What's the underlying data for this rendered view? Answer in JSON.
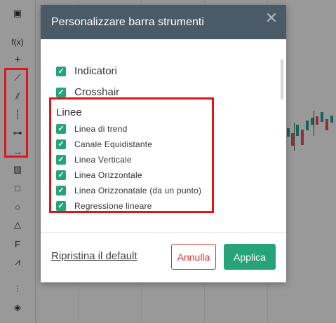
{
  "toolbar": {
    "tools": [
      {
        "icon": "chart-type-icon",
        "glyph": "▣"
      },
      {
        "icon": "function-icon",
        "glyph": "f(x)"
      },
      {
        "icon": "crosshair-icon",
        "glyph": "+"
      },
      {
        "icon": "trend-line-icon",
        "glyph": "⟋"
      },
      {
        "icon": "equidistant-channel-icon",
        "glyph": "⫽"
      },
      {
        "icon": "vertical-line-icon",
        "glyph": "┆"
      },
      {
        "icon": "horizontal-line-icon",
        "glyph": "⊶"
      },
      {
        "icon": "horizontal-ray-icon",
        "glyph": "→"
      },
      {
        "icon": "volume-profile-icon",
        "glyph": "▥"
      },
      {
        "icon": "rectangle-icon",
        "glyph": "□"
      },
      {
        "icon": "circle-icon",
        "glyph": "○"
      },
      {
        "icon": "triangle-icon",
        "glyph": "△"
      },
      {
        "icon": "fibonacci-icon",
        "glyph": "F"
      },
      {
        "icon": "zigzag-icon",
        "glyph": "⩘"
      },
      {
        "icon": "indicator-settings-icon",
        "glyph": "⫶"
      },
      {
        "icon": "layers-icon",
        "glyph": "◈"
      }
    ]
  },
  "modal": {
    "title": "Personalizzare barra strumenti",
    "close_glyph": "✕",
    "check_glyph": "✓",
    "top_items": [
      {
        "label": "Indicatori"
      },
      {
        "label": "Crosshair"
      }
    ],
    "section_title": "Linee",
    "section_items": [
      {
        "label": "Linea di trend"
      },
      {
        "label": "Canale Equidistante"
      },
      {
        "label": "Linea Verticale"
      },
      {
        "label": "Linea Orizzontale"
      },
      {
        "label": "Linea Orizzonatale (da un punto)"
      },
      {
        "label": "Regressione lineare"
      }
    ],
    "reset_label": "Ripristina il default",
    "cancel_label": "Annulla",
    "apply_label": "Applica"
  },
  "colors": {
    "header_bg": "#4a5a66",
    "check_green": "#27a37a",
    "highlight_red": "#e0141c",
    "cancel_red": "#dd3333"
  }
}
